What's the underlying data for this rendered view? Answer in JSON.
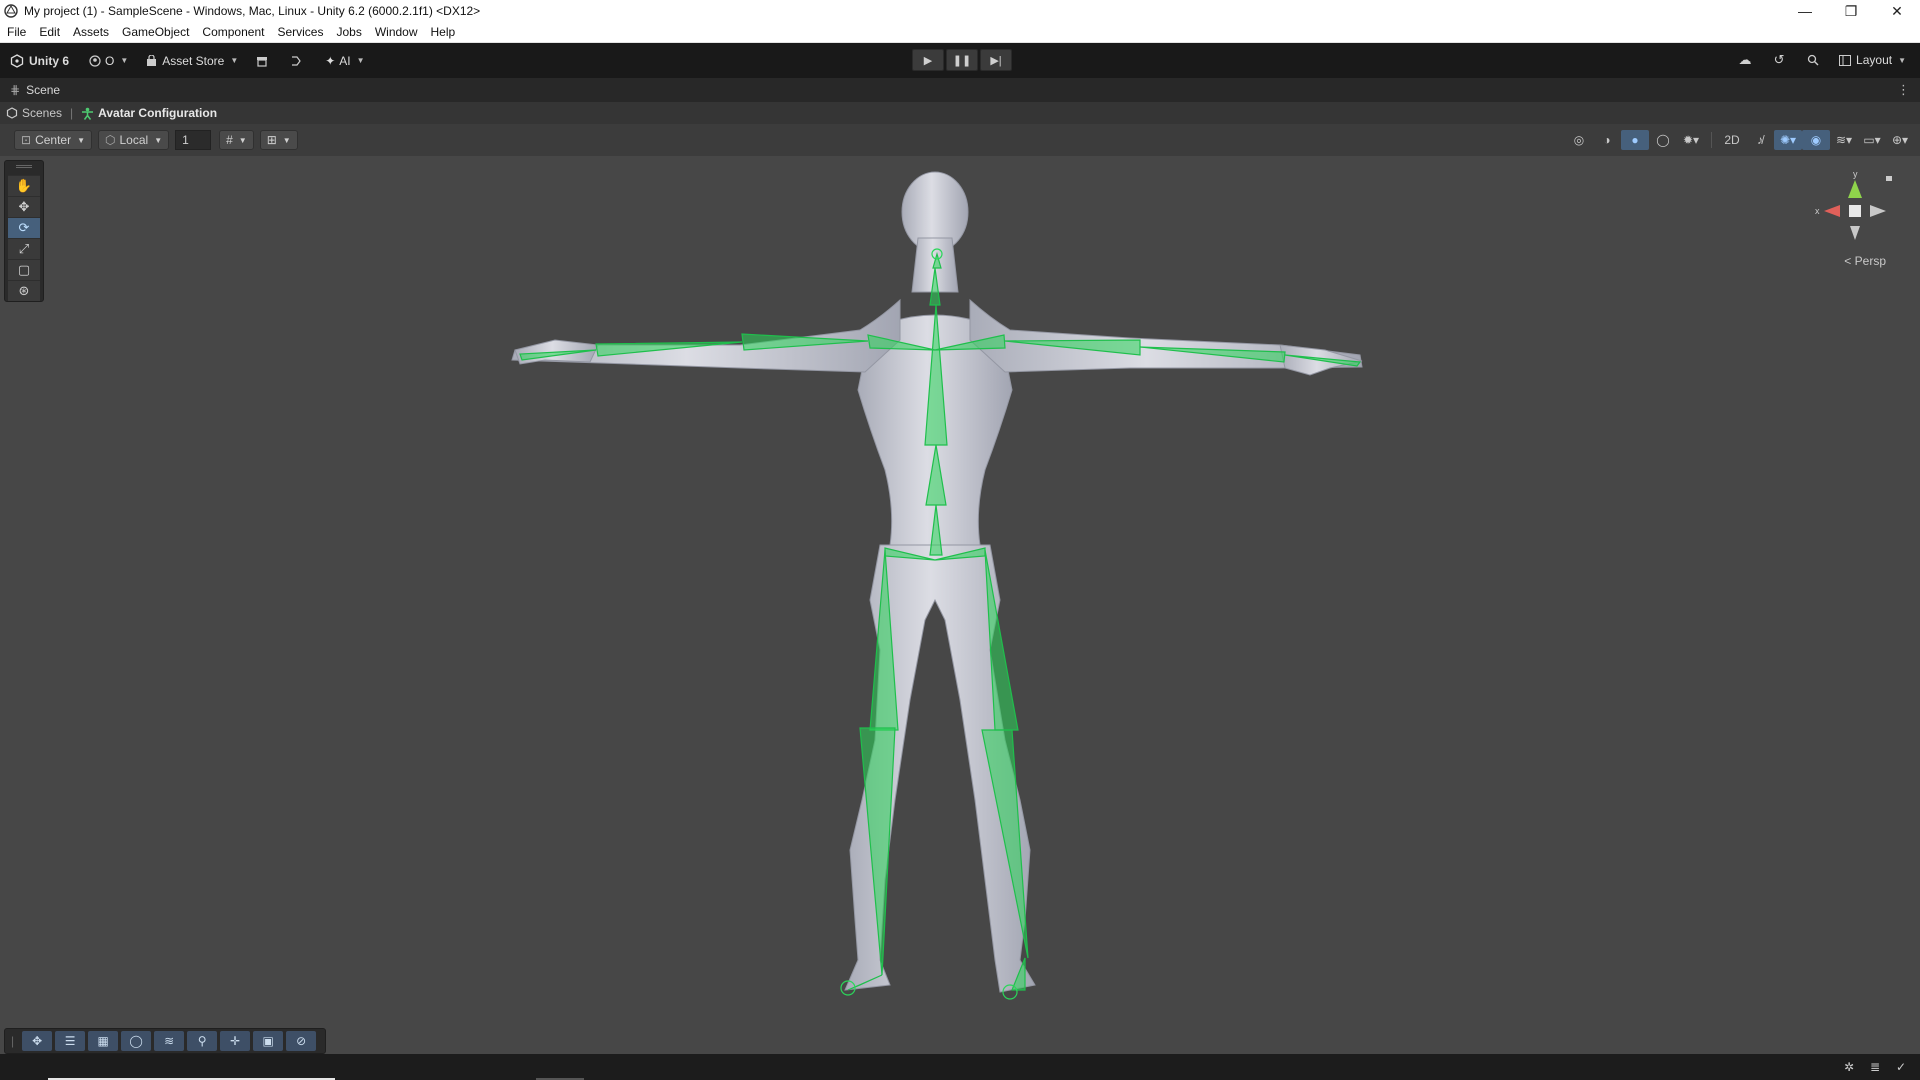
{
  "window": {
    "title": "My project (1) - SampleScene - Windows, Mac, Linux - Unity 6.2 (6000.2.1f1) <DX12>",
    "minimize": "—",
    "restore": "❐",
    "close": "✕"
  },
  "menu": [
    "File",
    "Edit",
    "Assets",
    "GameObject",
    "Component",
    "Services",
    "Jobs",
    "Window",
    "Help"
  ],
  "toolbar": {
    "unity_label": "Unity 6",
    "account_label": "O",
    "asset_store_label": "Asset Store",
    "ai_label": "AI",
    "layout_label": "Layout"
  },
  "tab": {
    "scene_label": "Scene"
  },
  "breadcrumb": {
    "root": "Scenes",
    "current": "Avatar Configuration"
  },
  "scene_toolbar": {
    "pivot_label": "Center",
    "space_label": "Local",
    "grid_value": "1"
  },
  "gizmo": {
    "y_label": "y",
    "x_label": "x",
    "view_label": "< Persp"
  },
  "colors": {
    "bone": "#2bd65a",
    "accent": "#46607c",
    "body": "#c2c5cf"
  }
}
